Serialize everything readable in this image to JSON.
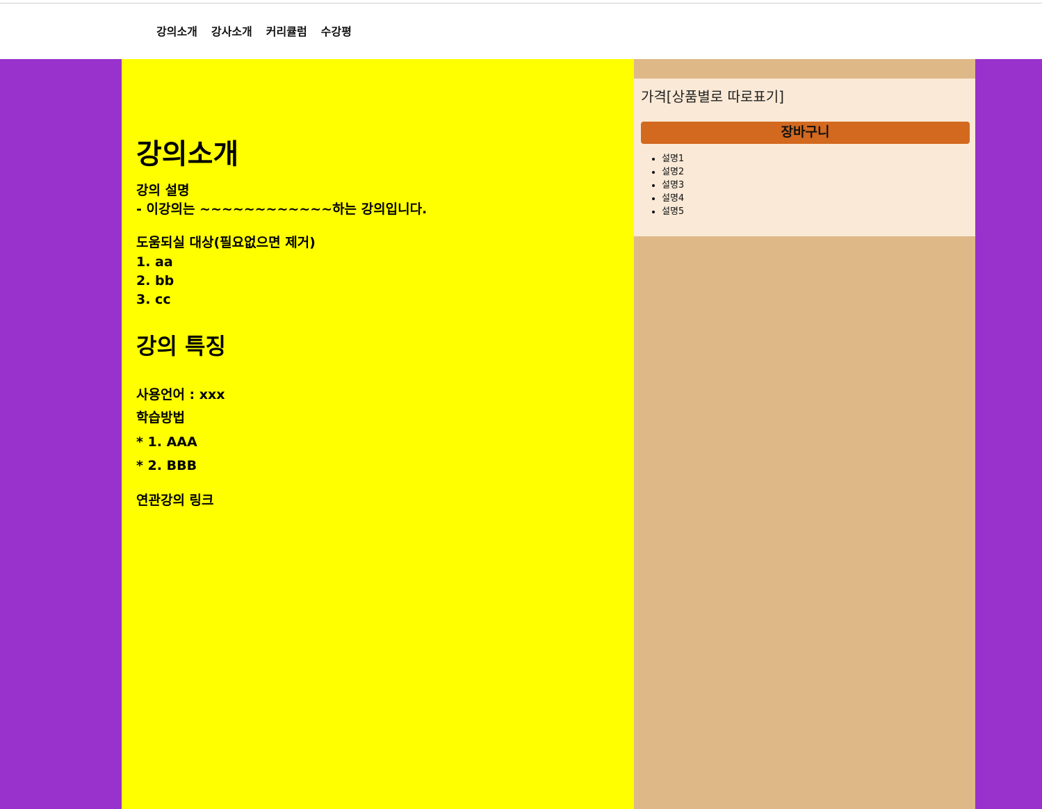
{
  "nav": {
    "items": [
      "강의소개",
      "강사소개",
      "커리큘럼",
      "수강평"
    ]
  },
  "main": {
    "title": "강의소개",
    "desc_heading": "강의 설명",
    "desc_text": "- 이강의는 ~~~~~~~~~~~~하는 강의입니다.",
    "target_heading": "도움되실 대상(필요없으면 제거)",
    "targets": [
      "1. aa",
      "2. bb",
      "3. cc"
    ],
    "features_title": "강의 특징",
    "language": "사용언어 : xxx",
    "method_heading": "학습방법",
    "methods": [
      "* 1. AAA",
      "* 2. BBB"
    ],
    "related": "연관강의 링크"
  },
  "side": {
    "price": "가격[상품별로 따로표기]",
    "cart_label": "장바구니",
    "items": [
      "설명1",
      "설명2",
      "설명3",
      "설명4",
      "설명5"
    ]
  },
  "colors": {
    "page_bg": "#9932cc",
    "main_bg": "#ffff00",
    "side_bg": "#deb887",
    "side_box_bg": "#fae9d6",
    "cart_bg": "#d2691e"
  }
}
